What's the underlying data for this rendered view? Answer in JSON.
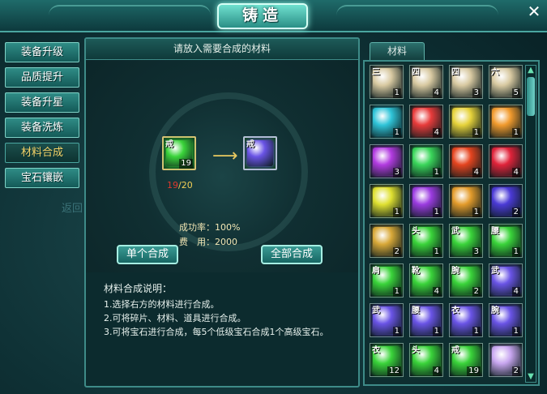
{
  "window": {
    "title": "铸造",
    "close_label": "✕"
  },
  "menu": {
    "items": [
      {
        "label": "装备升级"
      },
      {
        "label": "品质提升"
      },
      {
        "label": "装备升星"
      },
      {
        "label": "装备洗炼"
      },
      {
        "label": "材料合成",
        "active": true
      },
      {
        "label": "宝石镶嵌"
      }
    ],
    "background_text": "返回"
  },
  "craft": {
    "header": "请放入需要合成的材料",
    "input_item": {
      "label": "戒",
      "count": "19",
      "color": "#3ad43a"
    },
    "output_item": {
      "label": "戒",
      "color": "#6a54e6"
    },
    "arrow": "⟶",
    "count_have": "19",
    "count_sep": "/",
    "count_need": "20",
    "success_label": "成功率：100%",
    "cost_label": "费　用：2000",
    "single_button": "单个合成",
    "all_button": "全部合成"
  },
  "description": {
    "title": "材料合成说明：",
    "lines": [
      "1.选择右方的材料进行合成。",
      "2.可将碎片、材料、道具进行合成。",
      "3.可将宝石进行合成，每5个低级宝石合成1个高级宝石。"
    ]
  },
  "inventory": {
    "tab_label": "材料",
    "rows": [
      [
        {
          "label": "三",
          "count": "1",
          "color": "#d8c9a1"
        },
        {
          "label": "四",
          "count": "4",
          "color": "#d8c9a1"
        },
        {
          "label": "四",
          "count": "3",
          "color": "#d8c9a1"
        },
        {
          "label": "六",
          "count": "5",
          "color": "#d8c9a1"
        }
      ],
      [
        {
          "label": "",
          "count": "1",
          "color": "#2fc4d8"
        },
        {
          "label": "",
          "count": "4",
          "color": "#e83b3b"
        },
        {
          "label": "",
          "count": "1",
          "color": "#e6d23a"
        },
        {
          "label": "",
          "count": "1",
          "color": "#f19a2d"
        }
      ],
      [
        {
          "label": "",
          "count": "3",
          "color": "#b23be0"
        },
        {
          "label": "",
          "count": "1",
          "color": "#3ad65a"
        },
        {
          "label": "",
          "count": "4",
          "color": "#e5441f"
        },
        {
          "label": "",
          "count": "4",
          "color": "#e0233a"
        }
      ],
      [
        {
          "label": "",
          "count": "1",
          "color": "#dfe030"
        },
        {
          "label": "",
          "count": "1",
          "color": "#9b3be0"
        },
        {
          "label": "",
          "count": "1",
          "color": "#e39b2b"
        },
        {
          "label": "",
          "count": "2",
          "color": "#4b3ad6"
        }
      ],
      [
        {
          "label": "",
          "count": "2",
          "color": "#d8a838"
        },
        {
          "label": "头",
          "count": "1",
          "color": "#3ad43a"
        },
        {
          "label": "武",
          "count": "3",
          "color": "#3ad43a"
        },
        {
          "label": "腰",
          "count": "1",
          "color": "#3ad43a"
        }
      ],
      [
        {
          "label": "肩",
          "count": "1",
          "color": "#3ad43a"
        },
        {
          "label": "靴",
          "count": "4",
          "color": "#3ad43a"
        },
        {
          "label": "腕",
          "count": "2",
          "color": "#3ad43a"
        },
        {
          "label": "武",
          "count": "4",
          "color": "#6a54e6"
        }
      ],
      [
        {
          "label": "武",
          "count": "1",
          "color": "#6a54e6"
        },
        {
          "label": "腰",
          "count": "1",
          "color": "#6a54e6"
        },
        {
          "label": "衣",
          "count": "1",
          "color": "#6a54e6"
        },
        {
          "label": "腕",
          "count": "1",
          "color": "#6a54e6"
        }
      ],
      [
        {
          "label": "衣",
          "count": "12",
          "color": "#3ad43a"
        },
        {
          "label": "头",
          "count": "4",
          "color": "#3ad43a"
        },
        {
          "label": "戒",
          "count": "19",
          "color": "#3ad43a"
        },
        {
          "label": "",
          "count": "2",
          "color": "#c8a6f0"
        }
      ]
    ],
    "scroll_up": "▲",
    "scroll_down": "▼"
  }
}
